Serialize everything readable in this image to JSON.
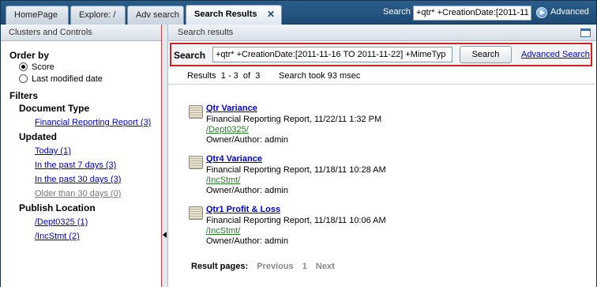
{
  "tabs": [
    {
      "label": "HomePage"
    },
    {
      "label": "Explore: /"
    },
    {
      "label": "Adv search"
    },
    {
      "label": "Search Results"
    }
  ],
  "topbar": {
    "search_label": "Search",
    "search_value": "+qtr* +CreationDate:[2011-11",
    "advanced_label": "Advanced",
    "close_glyph": "✕"
  },
  "left": {
    "header": "Clusters and Controls",
    "order_by_title": "Order by",
    "order_options": [
      "Score",
      "Last modified date"
    ],
    "filters_title": "Filters",
    "doc_type_title": "Document Type",
    "doc_type_items": [
      "Financial Reporting Report (3)"
    ],
    "updated_title": "Updated",
    "updated_items": [
      "Today (1)",
      "In the past 7 days (3)",
      "In the past 30 days (3)",
      "Older than 30 days (0)"
    ],
    "publish_title": "Publish Location",
    "publish_items": [
      "/Dept0325 (1)",
      "/IncStmt (2)"
    ]
  },
  "main": {
    "header": "Search results",
    "search_label": "Search",
    "search_value": "+qtr* +CreationDate:[2011-11-16 TO 2011-11-22] +MimeTyp",
    "search_button": "Search",
    "advanced_link": "Advanced Search",
    "results_count": "Results  1 - 3  of  3",
    "search_time": "Search took 93 msec",
    "results": [
      {
        "title": "Qtr Variance",
        "meta": "Financial Reporting Report, 11/22/11 1:32 PM",
        "path": "/Dept0325/",
        "owner": "Owner/Author: admin"
      },
      {
        "title": "Qtr4 Variance",
        "meta": "Financial Reporting Report, 11/18/11 10:28 AM",
        "path": "/IncStmt/",
        "owner": "Owner/Author: admin"
      },
      {
        "title": "Qtr1 Profit & Loss",
        "meta": "Financial Reporting Report, 11/18/11 10:06 AM",
        "path": "/IncStmt/",
        "owner": "Owner/Author: admin"
      }
    ],
    "pages_label": "Result pages:",
    "pages_prev": "Previous",
    "pages_current": "1",
    "pages_next": "Next"
  }
}
